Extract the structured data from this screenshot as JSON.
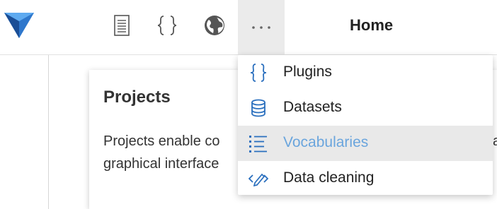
{
  "header": {
    "nav_home_label": "Home",
    "icons": [
      "document-icon",
      "braces-icon",
      "globe-icon",
      "more-icon"
    ],
    "more_label": "···"
  },
  "card": {
    "title": "Projects",
    "body_line1": "Projects enable co",
    "body_line1_tail": "a",
    "body_line2": "graphical interface"
  },
  "dropdown": {
    "items": [
      {
        "label": "Plugins",
        "icon": "braces-icon"
      },
      {
        "label": "Datasets",
        "icon": "database-icon"
      },
      {
        "label": "Vocabularies",
        "icon": "list-icon",
        "active": true
      },
      {
        "label": "Data cleaning",
        "icon": "pencil-code-icon"
      }
    ]
  },
  "colors": {
    "accent": "#2a6fbe",
    "active_text": "#6aa5dd",
    "logo": "#2b6cb8"
  }
}
